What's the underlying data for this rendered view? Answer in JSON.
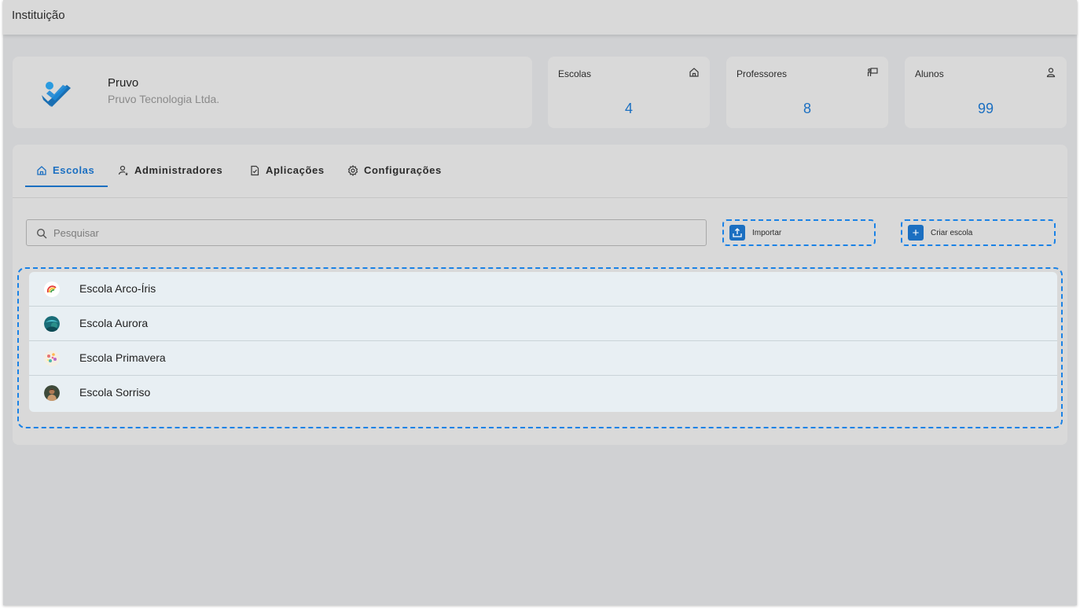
{
  "header": {
    "title": "Instituição"
  },
  "organization": {
    "name": "Pruvo",
    "legal_name": "Pruvo Tecnologia Ltda."
  },
  "stats": [
    {
      "label": "Escolas",
      "value": "4",
      "icon": "home-icon"
    },
    {
      "label": "Professores",
      "value": "8",
      "icon": "teacher-board-icon"
    },
    {
      "label": "Alunos",
      "value": "99",
      "icon": "user-icon"
    }
  ],
  "tabs": [
    {
      "label": "Escolas",
      "icon": "home-icon",
      "active": true
    },
    {
      "label": "Administradores",
      "icon": "user-star-icon",
      "active": false
    },
    {
      "label": "Aplicações",
      "icon": "document-check-icon",
      "active": false
    },
    {
      "label": "Configurações",
      "icon": "gear-icon",
      "active": false
    }
  ],
  "search": {
    "placeholder": "Pesquisar",
    "value": ""
  },
  "actions": {
    "import_label": "Importar",
    "create_label": "Criar escola"
  },
  "schools": [
    {
      "name": "Escola Arco-Íris"
    },
    {
      "name": "Escola Aurora"
    },
    {
      "name": "Escola Primavera"
    },
    {
      "name": "Escola Sorriso"
    }
  ],
  "colors": {
    "accent": "#1b6fc1",
    "highlight": "#1a82e6",
    "list_bg": "#e8eff3"
  }
}
